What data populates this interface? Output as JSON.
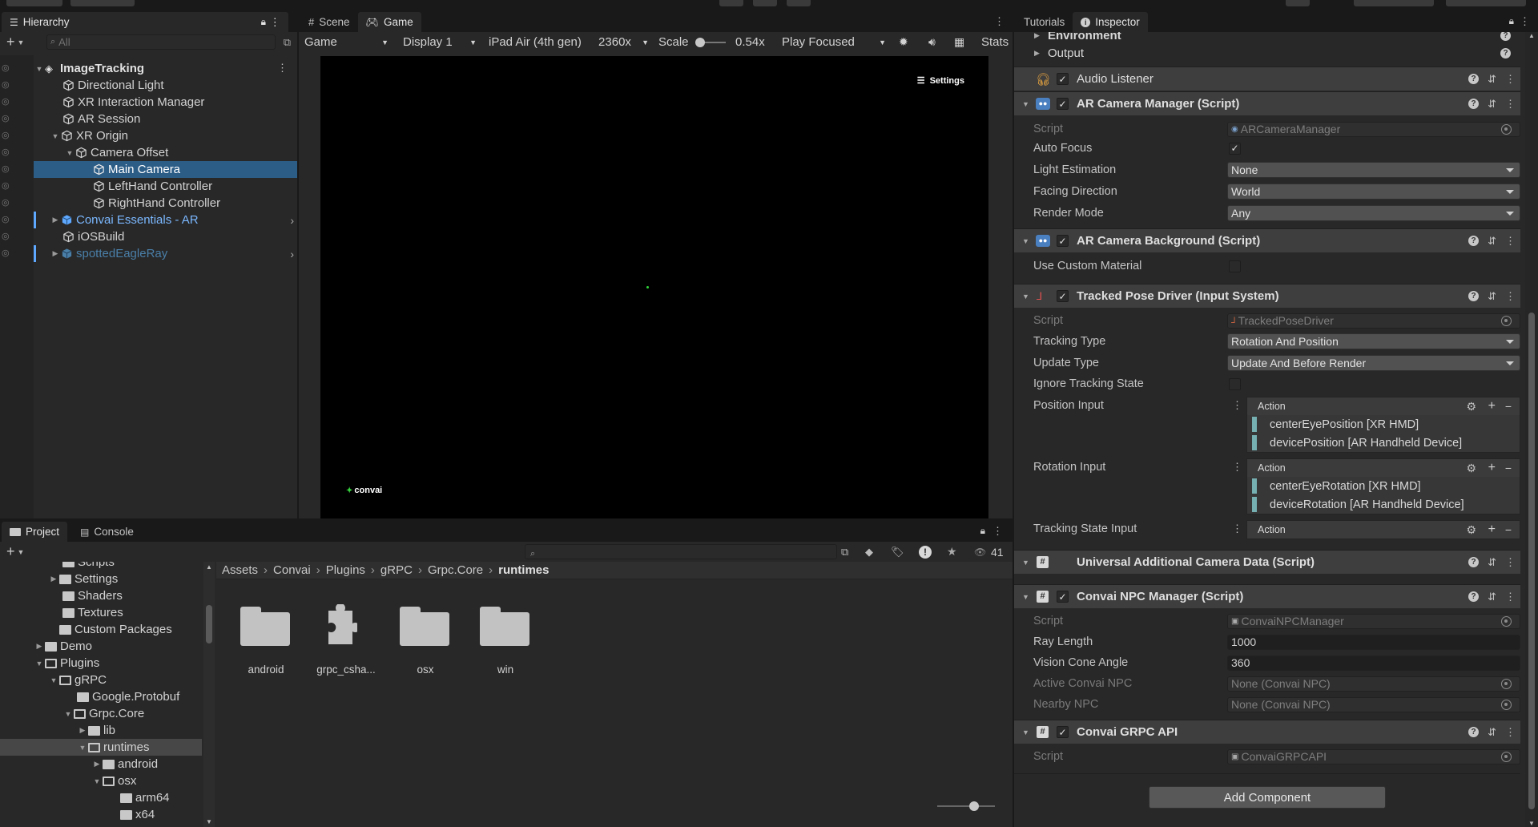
{
  "colors": {
    "selection": "#2c5d87",
    "accent_blue": "#7bb8ff",
    "prefab_blue": "#5ea8ff",
    "faded_blue": "#4a7fa8",
    "checkbox_teal": "#76b0b3"
  },
  "hierarchy": {
    "tab_label": "Hierarchy",
    "search_placeholder": "All",
    "add_label": "+",
    "scene": "ImageTracking",
    "items": [
      {
        "label": "Directional Light"
      },
      {
        "label": "XR Interaction Manager"
      },
      {
        "label": "AR Session"
      },
      {
        "label": "XR Origin"
      },
      {
        "label": "Camera Offset"
      },
      {
        "label": "Main Camera"
      },
      {
        "label": "LeftHand Controller"
      },
      {
        "label": "RightHand Controller"
      },
      {
        "label": "Convai Essentials - AR"
      },
      {
        "label": "iOSBuild"
      },
      {
        "label": "spottedEagleRay"
      }
    ]
  },
  "game": {
    "tabs": [
      {
        "label": "Scene",
        "icon": "grid-icon"
      },
      {
        "label": "Game",
        "icon": "gamepad-icon"
      }
    ],
    "toolbar": {
      "game": "Game",
      "display": "Display 1",
      "device": "iPad Air (4th gen)",
      "resolution": "2360x",
      "scale_label": "Scale",
      "scale_value": "0.54x",
      "play_mode": "Play Focused",
      "stats": "Stats"
    },
    "overlay_settings": "Settings",
    "logo": "convai"
  },
  "project": {
    "tabs": [
      {
        "label": "Project"
      },
      {
        "label": "Console"
      }
    ],
    "count": "41",
    "tree": [
      {
        "label": "Scripts"
      },
      {
        "label": "Settings"
      },
      {
        "label": "Shaders"
      },
      {
        "label": "Textures"
      },
      {
        "label": "Custom Packages"
      },
      {
        "label": "Demo"
      },
      {
        "label": "Plugins"
      },
      {
        "label": "gRPC"
      },
      {
        "label": "Google.Protobuf"
      },
      {
        "label": "Grpc.Core"
      },
      {
        "label": "lib"
      },
      {
        "label": "runtimes"
      },
      {
        "label": "android"
      },
      {
        "label": "osx"
      },
      {
        "label": "arm64"
      },
      {
        "label": "x64"
      }
    ],
    "breadcrumb": [
      "Assets",
      "Convai",
      "Plugins",
      "gRPC",
      "Grpc.Core",
      "runtimes"
    ],
    "assets": [
      {
        "label": "android"
      },
      {
        "label": "grpc_csha..."
      },
      {
        "label": "osx"
      },
      {
        "label": "win"
      }
    ]
  },
  "inspector": {
    "tabs": [
      {
        "label": "Tutorials"
      },
      {
        "label": "Inspector"
      }
    ],
    "top_rows": {
      "environment": "Environment",
      "output": "Output"
    },
    "audio_listener": "Audio Listener",
    "ar_camera_manager": {
      "title": "AR Camera Manager (Script)",
      "script_label": "Script",
      "script_value": "ARCameraManager",
      "auto_focus_label": "Auto Focus",
      "auto_focus_value": "✓",
      "light_label": "Light Estimation",
      "light_value": "None",
      "facing_label": "Facing Direction",
      "facing_value": "World",
      "render_label": "Render Mode",
      "render_value": "Any"
    },
    "ar_camera_background": {
      "title": "AR Camera Background (Script)",
      "custom_label": "Use Custom Material"
    },
    "tracked_pose": {
      "title": "Tracked Pose Driver (Input System)",
      "script_label": "Script",
      "script_value": "TrackedPoseDriver",
      "tracking_type_label": "Tracking Type",
      "tracking_type_value": "Rotation And Position",
      "update_type_label": "Update Type",
      "update_type_value": "Update And Before Render",
      "ignore_label": "Ignore Tracking State",
      "position_label": "Position Input",
      "rotation_label": "Rotation Input",
      "state_label": "Tracking State Input",
      "action_label": "Action",
      "position_items": [
        "centerEyePosition [XR HMD]",
        "devicePosition [AR Handheld Device]"
      ],
      "rotation_items": [
        "centerEyeRotation [XR HMD]",
        "deviceRotation [AR Handheld Device]"
      ]
    },
    "universal_camera": {
      "title": "Universal Additional Camera Data (Script)"
    },
    "npc_manager": {
      "title": "Convai NPC Manager (Script)",
      "script_label": "Script",
      "script_value": "ConvaiNPCManager",
      "ray_label": "Ray Length",
      "ray_value": "1000",
      "cone_label": "Vision Cone Angle",
      "cone_value": "360",
      "active_label": "Active Convai NPC",
      "active_value": "None (Convai NPC)",
      "nearby_label": "Nearby NPC",
      "nearby_value": "None (Convai NPC)"
    },
    "grpc_api": {
      "title": "Convai GRPC API",
      "script_label": "Script",
      "script_value": "ConvaiGRPCAPI"
    },
    "add_component": "Add Component"
  }
}
